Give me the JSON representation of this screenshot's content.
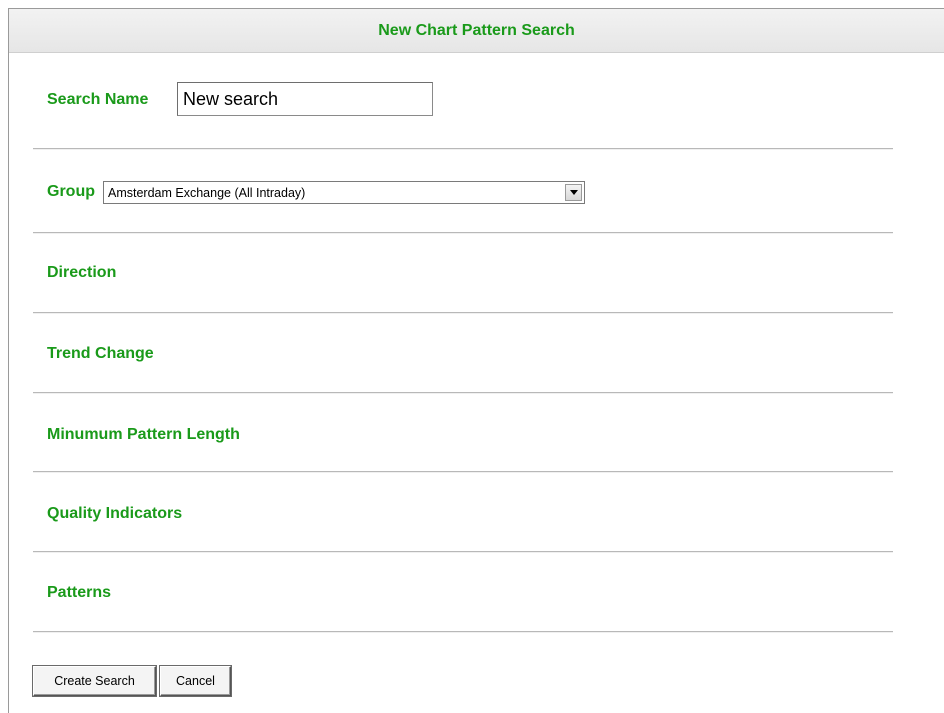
{
  "header": {
    "title": "New Chart Pattern Search"
  },
  "form": {
    "search_name": {
      "label": "Search Name",
      "value": "New search"
    },
    "group": {
      "label": "Group",
      "selected": "Amsterdam Exchange (All Intraday)"
    },
    "sections": [
      {
        "label": "Direction"
      },
      {
        "label": "Trend Change"
      },
      {
        "label": "Minumum Pattern Length"
      },
      {
        "label": "Quality Indicators"
      },
      {
        "label": "Patterns"
      }
    ]
  },
  "buttons": {
    "create_label": "Create Search",
    "cancel_label": "Cancel"
  },
  "colors": {
    "label_green": "#1a9a1a"
  },
  "icons": {
    "dropdown": "chevron-down-icon"
  }
}
